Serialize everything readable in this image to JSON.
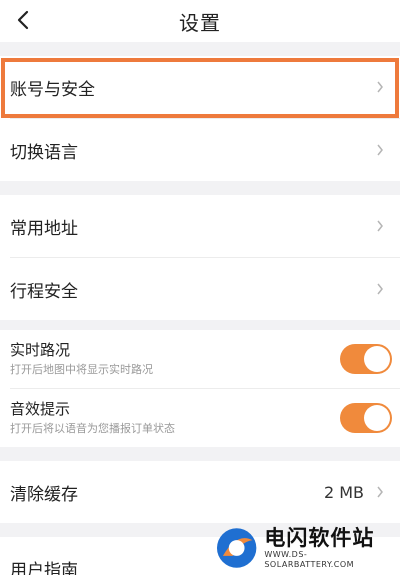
{
  "header": {
    "title": "设置"
  },
  "account": {
    "label": "账号与安全"
  },
  "language": {
    "label": "切换语言"
  },
  "address": {
    "label": "常用地址"
  },
  "trip_safety": {
    "label": "行程安全"
  },
  "realtime_traffic": {
    "title": "实时路况",
    "subtitle": "打开后地图中将显示实时路况",
    "enabled": true
  },
  "sound_prompt": {
    "title": "音效提示",
    "subtitle": "打开后将以语音为您播报订单状态",
    "enabled": true
  },
  "cache": {
    "label": "清除缓存",
    "value": "2 MB"
  },
  "guide": {
    "label": "用户指南"
  },
  "watermark": {
    "title": "电闪软件站",
    "url": "WWW.DS-SOLARBATTERY.COM"
  },
  "colors": {
    "accent": "#f08a3c",
    "highlight": "#ee7a3c",
    "background": "#f2f2f4"
  }
}
